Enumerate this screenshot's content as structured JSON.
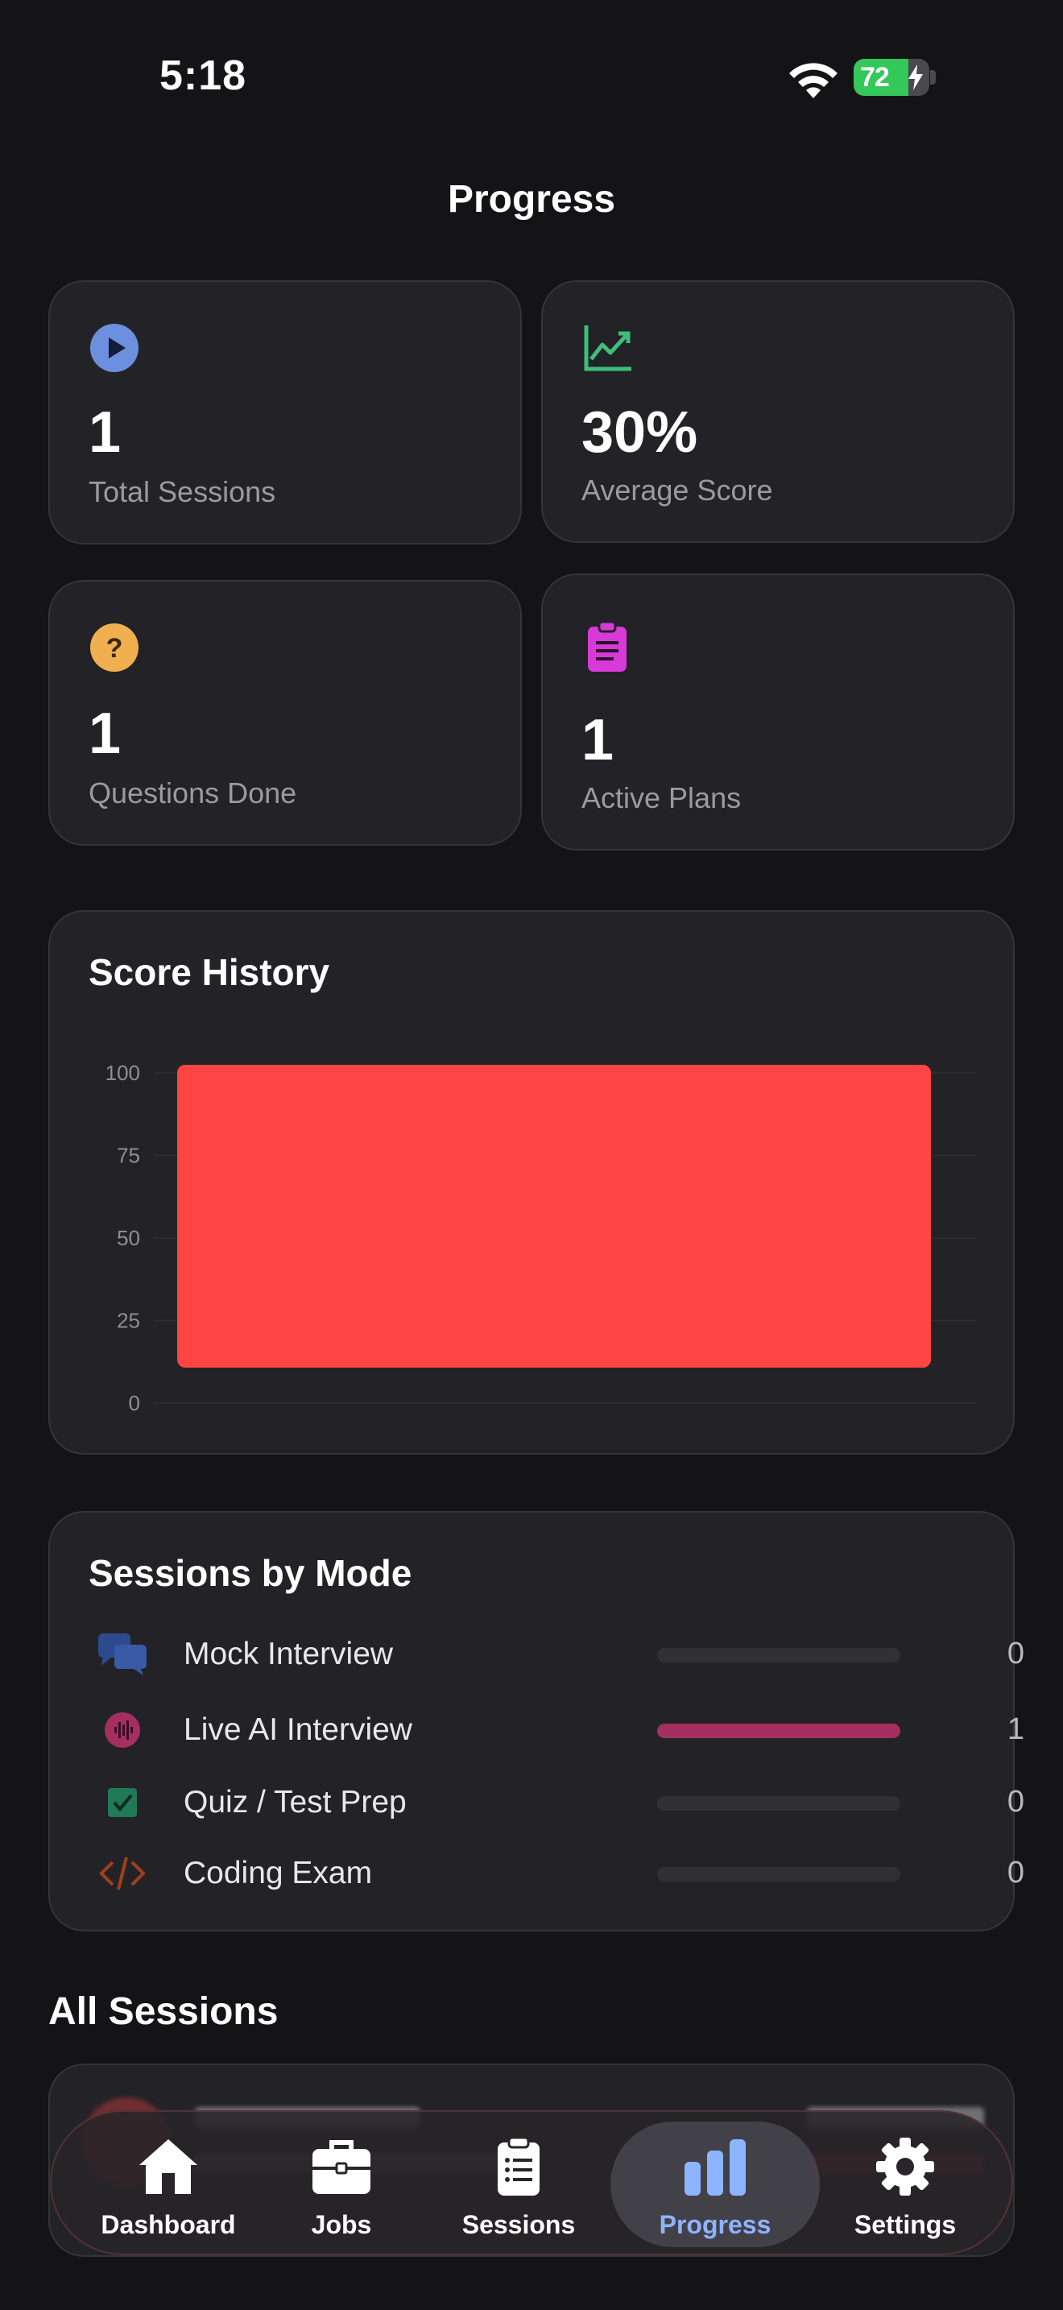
{
  "status_bar": {
    "time": "5:18",
    "battery": "72",
    "battery_level": 0.72
  },
  "page_title": "Progress",
  "stats": [
    {
      "value": "1",
      "label": "Total Sessions",
      "icon": "play-circle-icon",
      "color": "#6d8fe0"
    },
    {
      "value": "30%",
      "label": "Average Score",
      "icon": "trending-up-icon",
      "color": "#3fbf7a"
    },
    {
      "value": "1",
      "label": "Questions Done",
      "icon": "question-circle-icon",
      "color": "#f0b050"
    },
    {
      "value": "1",
      "label": "Active Plans",
      "icon": "clipboard-icon",
      "color": "#d83ad8"
    }
  ],
  "score_history": {
    "title": "Score History",
    "chart_data": {
      "type": "bar",
      "categories": [
        ""
      ],
      "values": [
        100
      ],
      "ylim": [
        0,
        100
      ],
      "yticks": [
        "0",
        "25",
        "50",
        "75",
        "100"
      ],
      "grid": true,
      "bar_color": "#ff4444"
    }
  },
  "sessions_by_mode": {
    "title": "Sessions by Mode",
    "max": 1,
    "items": [
      {
        "label": "Mock Interview",
        "count": "0",
        "value": 0,
        "icon": "chat-bubbles-icon",
        "color": "#2e4a8f"
      },
      {
        "label": "Live AI Interview",
        "count": "1",
        "value": 1,
        "icon": "waveform-icon",
        "color": "#a5305f"
      },
      {
        "label": "Quiz / Test Prep",
        "count": "0",
        "value": 0,
        "icon": "checkbox-icon",
        "color": "#1f7a55"
      },
      {
        "label": "Coding Exam",
        "count": "0",
        "value": 0,
        "icon": "code-icon",
        "color": "#a0401a"
      }
    ]
  },
  "all_sessions": {
    "title": "All Sessions"
  },
  "tabs": [
    {
      "label": "Dashboard",
      "icon": "house-icon",
      "active": false
    },
    {
      "label": "Jobs",
      "icon": "briefcase-icon",
      "active": false
    },
    {
      "label": "Sessions",
      "icon": "clipboard-list-icon",
      "active": false
    },
    {
      "label": "Progress",
      "icon": "bar-chart-icon",
      "active": true
    },
    {
      "label": "Settings",
      "icon": "gear-icon",
      "active": false
    }
  ]
}
